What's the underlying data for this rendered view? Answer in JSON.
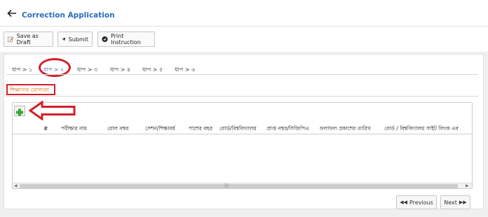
{
  "header": {
    "title": "Correction Application"
  },
  "toolbar": {
    "save_draft_label": "Save as Draft",
    "submit_label": "Submit",
    "print_label": "Print Instruction"
  },
  "steps": [
    {
      "label": "ধাপ > ১",
      "active": false
    },
    {
      "label": "ধাপ > ২",
      "active": true
    },
    {
      "label": "ধাপ > ৩",
      "active": false
    },
    {
      "label": "ধাপ > ৪",
      "active": false
    },
    {
      "label": "ধাপ > ৫",
      "active": false
    },
    {
      "label": "ধাপ > ৬",
      "active": false
    }
  ],
  "subtab": {
    "label": "শিক্ষাগত যোগ্যতা"
  },
  "grid": {
    "columns": [
      "#",
      "পরীক্ষার নাম",
      "রোল নম্বর",
      "সেশন/শিক্ষাবর্ষ",
      "পাশের বছর",
      "বোর্ড/বিশ্ববিদ্যালয়",
      "প্রাপ্ত নম্বর/সিজিপিএ",
      "ফলাফল প্রকাশের তারিখ",
      "বোর্ড / বিশ্ববিদ্যালয় সাইট লিংক এব"
    ],
    "rows": []
  },
  "pagination": {
    "previous_label": "Previous",
    "next_label": "Next"
  },
  "colors": {
    "accent": "#2a6ebb",
    "annotation_red": "#d0202a",
    "subtab_text": "#e06a00",
    "add_green": "#3aa832"
  }
}
